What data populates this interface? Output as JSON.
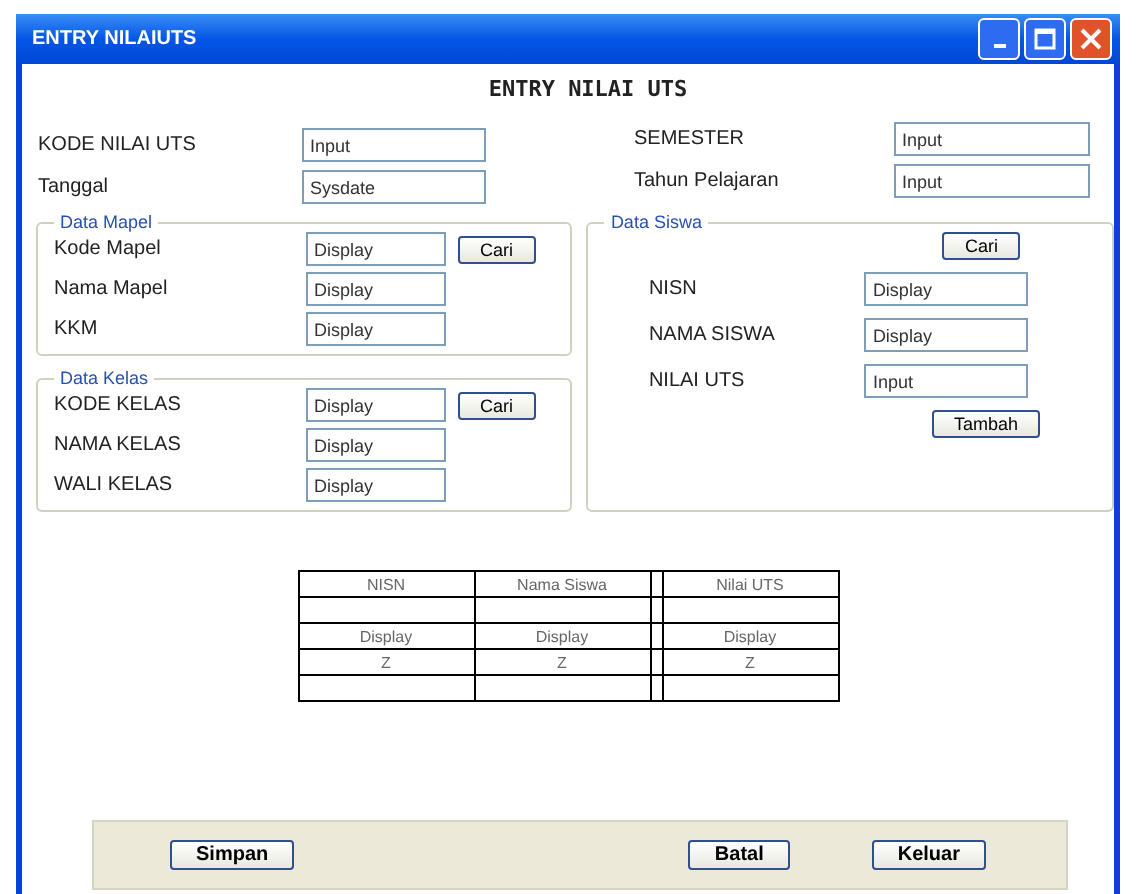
{
  "window": {
    "title": "ENTRY NILAIUTS"
  },
  "heading": "ENTRY NILAI UTS",
  "top_left": [
    {
      "label": "KODE NILAI UTS",
      "value": "Input"
    },
    {
      "label": "Tanggal",
      "value": "Sysdate"
    }
  ],
  "top_right": [
    {
      "label": "SEMESTER",
      "value": "Input"
    },
    {
      "label": "Tahun Pelajaran",
      "value": "Input"
    }
  ],
  "data_mapel": {
    "title": "Data Mapel",
    "button": "Cari",
    "fields": [
      {
        "label": "Kode Mapel",
        "value": "Display"
      },
      {
        "label": "Nama Mapel",
        "value": "Display"
      },
      {
        "label": "KKM",
        "value": "Display"
      }
    ]
  },
  "data_kelas": {
    "title": "Data Kelas",
    "button": "Cari",
    "fields": [
      {
        "label": "KODE KELAS",
        "value": "Display"
      },
      {
        "label": "NAMA KELAS",
        "value": "Display"
      },
      {
        "label": "WALI KELAS",
        "value": "Display"
      }
    ]
  },
  "data_siswa": {
    "title": "Data Siswa",
    "button": "Cari",
    "add_button": "Tambah",
    "fields": [
      {
        "label": "NISN",
        "value": "Display"
      },
      {
        "label": "NAMA SISWA",
        "value": "Display"
      },
      {
        "label": "NILAI UTS",
        "value": "Input"
      }
    ]
  },
  "table": {
    "columns": [
      "NISN",
      "Nama Siswa",
      "Nilai UTS"
    ],
    "rows": [
      [],
      [
        "Display",
        "Display",
        "Display"
      ],
      [
        "Z",
        "Z",
        "Z"
      ],
      []
    ]
  },
  "buttons": [
    "Simpan",
    "Batal",
    "Keluar"
  ]
}
